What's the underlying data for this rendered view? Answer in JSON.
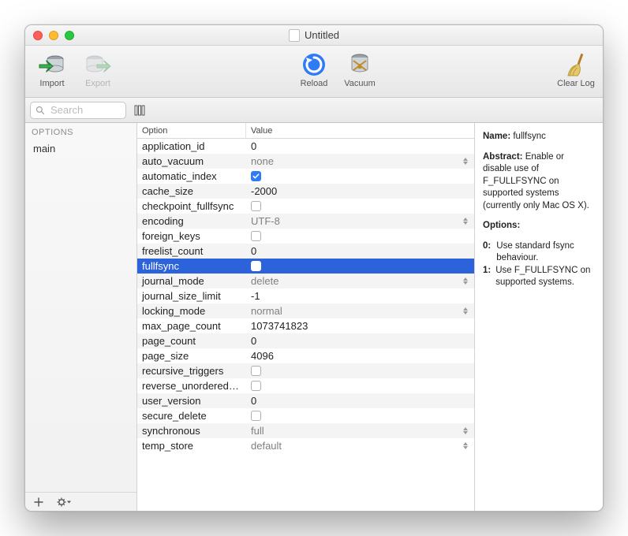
{
  "window": {
    "title": "Untitled"
  },
  "toolbar": {
    "import": "Import",
    "export": "Export",
    "reload": "Reload",
    "vacuum": "Vacuum",
    "clearlog": "Clear Log"
  },
  "search": {
    "placeholder": "Search"
  },
  "sidebar": {
    "header": "OPTIONS",
    "items": [
      {
        "label": "main"
      }
    ]
  },
  "table": {
    "columns": {
      "option": "Option",
      "value": "Value"
    },
    "rows": [
      {
        "option": "application_id",
        "kind": "number",
        "value": "0"
      },
      {
        "option": "auto_vacuum",
        "kind": "select",
        "value": "none"
      },
      {
        "option": "automatic_index",
        "kind": "check",
        "checked": true
      },
      {
        "option": "cache_size",
        "kind": "number",
        "value": "-2000"
      },
      {
        "option": "checkpoint_fullfsync",
        "kind": "check",
        "checked": false
      },
      {
        "option": "encoding",
        "kind": "select",
        "value": "UTF-8"
      },
      {
        "option": "foreign_keys",
        "kind": "check",
        "checked": false
      },
      {
        "option": "freelist_count",
        "kind": "plain",
        "value": "0"
      },
      {
        "option": "fullfsync",
        "kind": "check",
        "checked": false,
        "selected": true
      },
      {
        "option": "journal_mode",
        "kind": "select",
        "value": "delete"
      },
      {
        "option": "journal_size_limit",
        "kind": "number",
        "value": "-1"
      },
      {
        "option": "locking_mode",
        "kind": "select",
        "value": "normal"
      },
      {
        "option": "max_page_count",
        "kind": "number",
        "value": "1073741823"
      },
      {
        "option": "page_count",
        "kind": "plain",
        "value": "0"
      },
      {
        "option": "page_size",
        "kind": "number",
        "value": "4096"
      },
      {
        "option": "recursive_triggers",
        "kind": "check",
        "checked": false
      },
      {
        "option": "reverse_unordered…",
        "kind": "check",
        "checked": false
      },
      {
        "option": "user_version",
        "kind": "number",
        "value": "0"
      },
      {
        "option": "secure_delete",
        "kind": "check",
        "checked": false
      },
      {
        "option": "synchronous",
        "kind": "select",
        "value": "full"
      },
      {
        "option": "temp_store",
        "kind": "select",
        "value": "default"
      }
    ]
  },
  "detail": {
    "name_label": "Name:",
    "name_value": "fullfsync",
    "abstract_label": "Abstract:",
    "abstract_value": "Enable or disable use of F_FULLFSYNC on supported systems (currently only Mac OS X).",
    "options_label": "Options:",
    "options": [
      {
        "key": "0:",
        "text": "Use standard fsync behaviour."
      },
      {
        "key": "1:",
        "text": "Use F_FULLFSYNC on supported systems."
      }
    ]
  }
}
